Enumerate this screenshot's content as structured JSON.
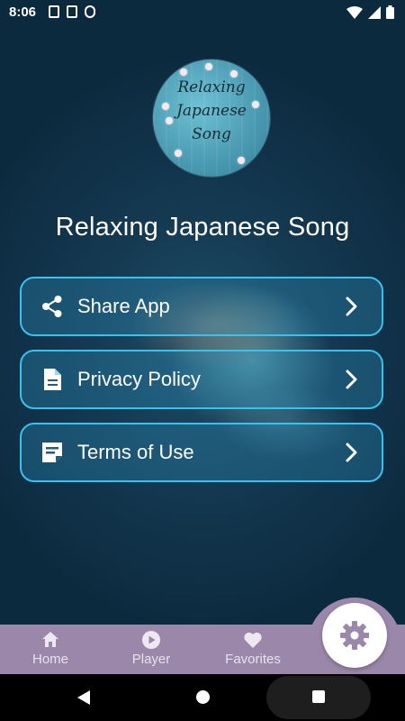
{
  "status_bar": {
    "time": "8:06"
  },
  "logo": {
    "line1": "Relaxing",
    "line2": "Japanese",
    "line3": "Song"
  },
  "app_title": "Relaxing Japanese Song",
  "menu": [
    {
      "label": "Share App",
      "icon": "share-icon"
    },
    {
      "label": "Privacy Policy",
      "icon": "document-icon"
    },
    {
      "label": "Terms of Use",
      "icon": "note-icon"
    }
  ],
  "bottom_nav": {
    "items": [
      {
        "label": "Home",
        "icon": "home-icon"
      },
      {
        "label": "Player",
        "icon": "play-circle-icon"
      },
      {
        "label": "Favorites",
        "icon": "heart-icon"
      }
    ],
    "fab_icon": "gear-icon",
    "colors": {
      "bar": "#9b87a9",
      "fab_icon": "#9b87a9"
    }
  },
  "colors": {
    "button_border": "#38c2ee",
    "background": "#143a52"
  }
}
